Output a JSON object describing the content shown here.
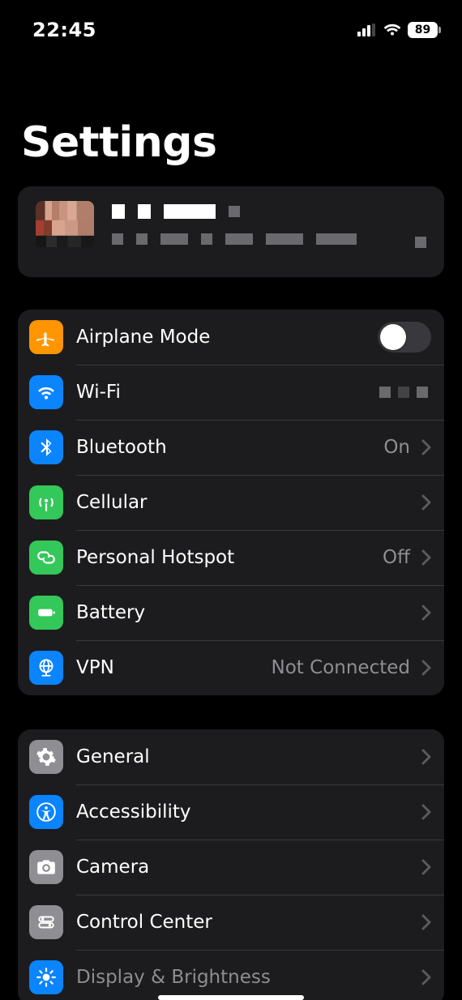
{
  "status": {
    "time": "22:45",
    "battery_percent": "89"
  },
  "title": "Settings",
  "profile": {
    "name_redacted": true,
    "subtitle_redacted": true
  },
  "group1": {
    "airplane": {
      "label": "Airplane Mode",
      "toggle": "off"
    },
    "wifi": {
      "label": "Wi-Fi",
      "detail_redacted": true
    },
    "bluetooth": {
      "label": "Bluetooth",
      "detail": "On"
    },
    "cellular": {
      "label": "Cellular"
    },
    "hotspot": {
      "label": "Personal Hotspot",
      "detail": "Off"
    },
    "battery": {
      "label": "Battery"
    },
    "vpn": {
      "label": "VPN",
      "detail": "Not Connected"
    }
  },
  "group2": {
    "general": {
      "label": "General"
    },
    "accessibility": {
      "label": "Accessibility"
    },
    "camera": {
      "label": "Camera"
    },
    "controlcenter": {
      "label": "Control Center"
    },
    "display": {
      "label": "Display & Brightness"
    }
  },
  "colors": {
    "orange": "#ff9500",
    "blue": "#0a84ff",
    "green": "#34c759",
    "grey": "#8e8e93"
  }
}
